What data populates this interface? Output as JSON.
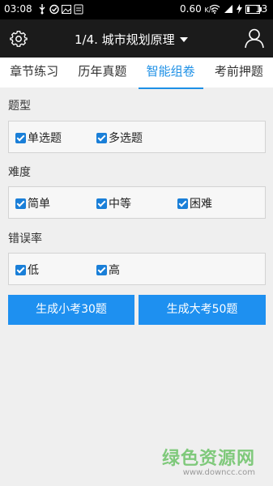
{
  "status_bar": {
    "time": "03:08",
    "left_icons": [
      "usb-icon",
      "sync-icon",
      "image-icon",
      "app-icon"
    ],
    "speed": "0.60",
    "speed_unit": "K/s",
    "battery": "13"
  },
  "app_bar": {
    "title": "1/4. 城市规划原理",
    "settings_icon": "gear-icon",
    "user_icon": "user-icon"
  },
  "tabs": [
    {
      "label": "章节练习",
      "active": false
    },
    {
      "label": "历年真题",
      "active": false
    },
    {
      "label": "智能组卷",
      "active": true
    },
    {
      "label": "考前押题",
      "active": false
    }
  ],
  "question_type": {
    "title": "题型",
    "options": [
      {
        "label": "单选题",
        "checked": true
      },
      {
        "label": "多选题",
        "checked": true
      }
    ]
  },
  "difficulty": {
    "title": "难度",
    "options": [
      {
        "label": "简单",
        "checked": true
      },
      {
        "label": "中等",
        "checked": true
      },
      {
        "label": "困难",
        "checked": true
      }
    ]
  },
  "error_rate": {
    "title": "错误率",
    "options": [
      {
        "label": "低",
        "checked": true
      },
      {
        "label": "高",
        "checked": true
      }
    ]
  },
  "buttons": {
    "small_exam": "生成小考30题",
    "big_exam": "生成大考50题"
  },
  "watermark": {
    "name": "绿色资源网",
    "url": "www.downcc.com"
  },
  "colors": {
    "accent": "#1e90e6",
    "button": "#1e90f0",
    "appbar": "#1b1b1b"
  }
}
